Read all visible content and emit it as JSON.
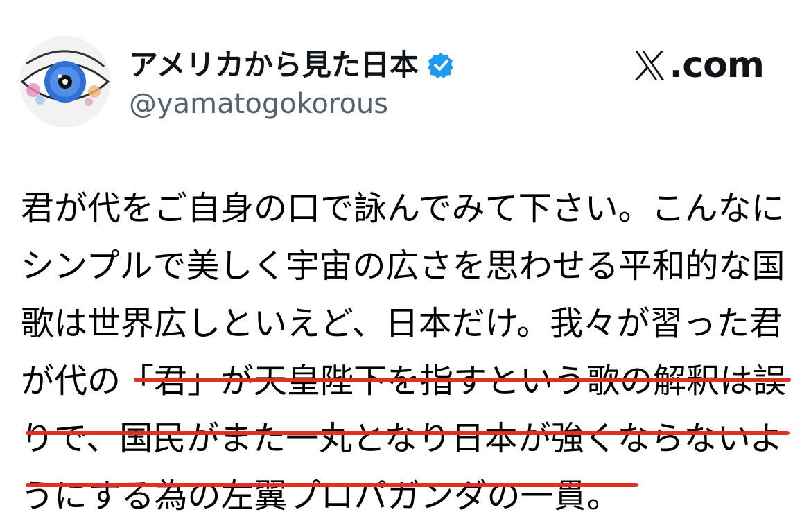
{
  "post": {
    "display_name": "アメリカから見た日本",
    "handle": "@yamatogokorous",
    "verified_icon": "verified-badge-icon",
    "avatar_icon": "eye-avatar",
    "brand_suffix": ".com",
    "brand_icon": "x-logo-icon",
    "lines": [
      "君が代をご自身の口で詠んでみて下さい。こんなに",
      "シンプルで美しく宇宙の広さを思わせる平和的な国",
      "歌は世界広しといえど、日本だけ。我々が習った君",
      "が代の「君」が天皇陛下を指すという歌の解釈は誤",
      "りで、国民がまた一丸となり日本が強くならないよ",
      "うにする為の左翼プロパガンダの一貫。"
    ]
  },
  "colors": {
    "verified": "#1d9bf0",
    "underline": "#e0301e",
    "handle": "#536471"
  }
}
